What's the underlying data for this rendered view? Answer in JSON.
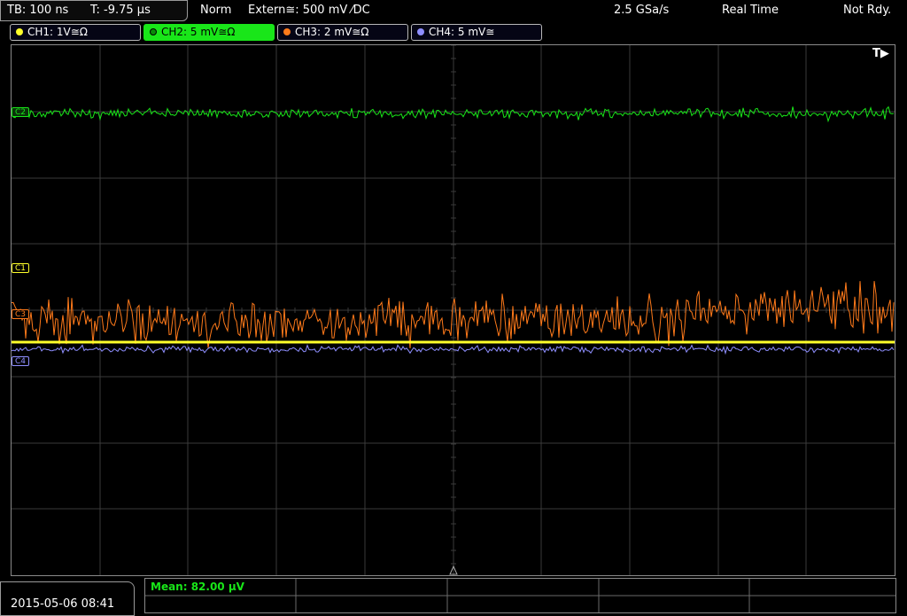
{
  "timebase": {
    "tb": "TB: 100 ns",
    "trigger_pos": "T: -9.75 µs"
  },
  "status": {
    "mode": "Norm",
    "trigger": "Extern≅: 500 mV ⁄DC",
    "sample_rate": "2.5 GSa/s",
    "acq": "Real Time",
    "state": "Not Rdy."
  },
  "channels": [
    {
      "label": "CH1: 1V≅Ω",
      "color": "#ffff2a"
    },
    {
      "label": "CH2: 5 mV≅Ω",
      "color": "#19e619"
    },
    {
      "label": "CH3: 2 mV≅Ω",
      "color": "#ff7a1a"
    },
    {
      "label": "CH4: 5 mV≅",
      "color": "#8f8fff"
    }
  ],
  "trigger_indicator": "T▶",
  "markers": {
    "c1": "C1",
    "c2": "C2",
    "c3": "C3",
    "c4": "C4"
  },
  "datetime": "2015-05-06 08:41",
  "measurement": "Mean: 82.00 µV"
}
